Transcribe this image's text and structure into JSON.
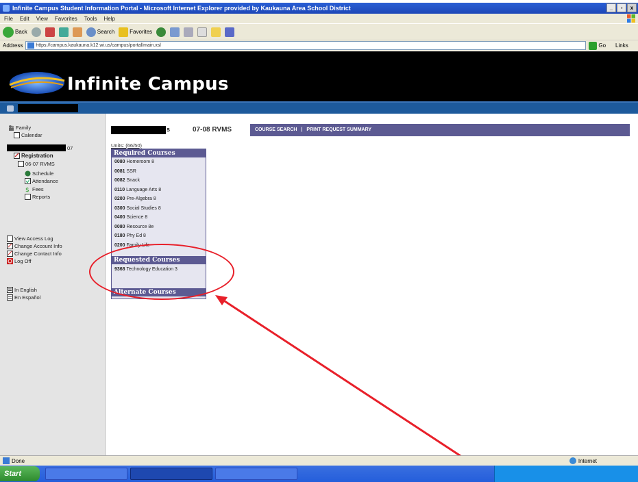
{
  "window": {
    "title": "Infinite Campus Student Information Portal - Microsoft Internet Explorer provided by Kaukauna Area School District"
  },
  "menu": [
    "File",
    "Edit",
    "View",
    "Favorites",
    "Tools",
    "Help"
  ],
  "toolbar": {
    "back_label": "Back",
    "search_label": "Search",
    "favorites_label": "Favorites"
  },
  "address": {
    "label": "Address",
    "url": "https://campus.kaukauna.k12.wi.us/campus/portal/main.xsl",
    "go_label": "Go",
    "links_label": "Links"
  },
  "banner": {
    "logo_text": "Infinite Campus"
  },
  "nav": {
    "family": "Family",
    "calendar": "Calendar",
    "student_suffix": "07",
    "registration": "Registration",
    "term": "06-07 RVMS",
    "schedule": "Schedule",
    "attendance": "Attendance",
    "fees": "Fees",
    "reports": "Reports",
    "view_access_log": "View Access Log",
    "change_account_info": "Change Account Info",
    "change_contact_info": "Change Contact Info",
    "log_off": "Log Off",
    "in_english": "In English",
    "en_espanol": "En Español"
  },
  "content": {
    "name_tail": "s",
    "term_label": "07-08 RVMS",
    "course_search": "COURSE SEARCH",
    "separator": "|",
    "print_request_summary": "PRINT REQUEST SUMMARY",
    "units": "Units: (66/50)",
    "required_heading": "Required Courses",
    "required_courses": [
      {
        "code": "0080",
        "name": "Homeroom 8"
      },
      {
        "code": "0081",
        "name": "SSR"
      },
      {
        "code": "0082",
        "name": "Snack"
      },
      {
        "code": "0110",
        "name": "Language Arts 8"
      },
      {
        "code": "0200",
        "name": "Pre-Algebra 8"
      },
      {
        "code": "0300",
        "name": "Social Studies 8"
      },
      {
        "code": "0400",
        "name": "Science 8"
      },
      {
        "code": "0080",
        "name": "Resource 8e"
      },
      {
        "code": "0180",
        "name": "Phy Ed 8"
      },
      {
        "code": "0200",
        "name": "Family Life"
      }
    ],
    "requested_heading": "Requested Courses",
    "requested_courses": [
      {
        "code": "9368",
        "name": "Technology Education 3"
      }
    ],
    "alternate_heading": "Alternate Courses"
  },
  "status": {
    "text": "Done",
    "zone": "Internet"
  },
  "colors": {
    "header_purple": "#5c5a92",
    "userbar_blue": "#1d5a9c",
    "annotation_red": "#e8202a"
  }
}
